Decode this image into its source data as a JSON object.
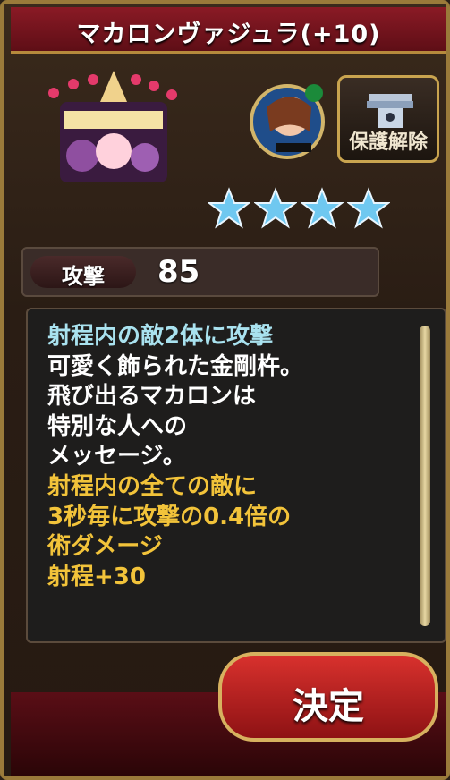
{
  "title": "マカロンヴァジュラ(+10)",
  "lock_button": {
    "label": "保護解除"
  },
  "stars": {
    "count": 4,
    "color": "#6fc8f0"
  },
  "attack": {
    "label": "攻撃",
    "value": "85"
  },
  "description": {
    "lines": [
      {
        "text": "射程内の敵2体に攻撃",
        "color": "blue"
      },
      {
        "text": "可愛く飾られた金剛杵。",
        "color": "white"
      },
      {
        "text": "飛び出るマカロンは",
        "color": "white"
      },
      {
        "text": "特別な人への",
        "color": "white"
      },
      {
        "text": "メッセージ。",
        "color": "white"
      },
      {
        "text": "射程内の全ての敵に",
        "color": "gold"
      },
      {
        "text": "3秒毎に攻撃の0.4倍の",
        "color": "gold"
      },
      {
        "text": "術ダメージ",
        "color": "gold"
      },
      {
        "text": "射程+30",
        "color": "gold"
      }
    ]
  },
  "confirm_button": {
    "label": "決定"
  },
  "colors": {
    "title_bg": "#7a1520",
    "accent_gold": "#c9a44f",
    "confirm_red": "#c92a26"
  }
}
